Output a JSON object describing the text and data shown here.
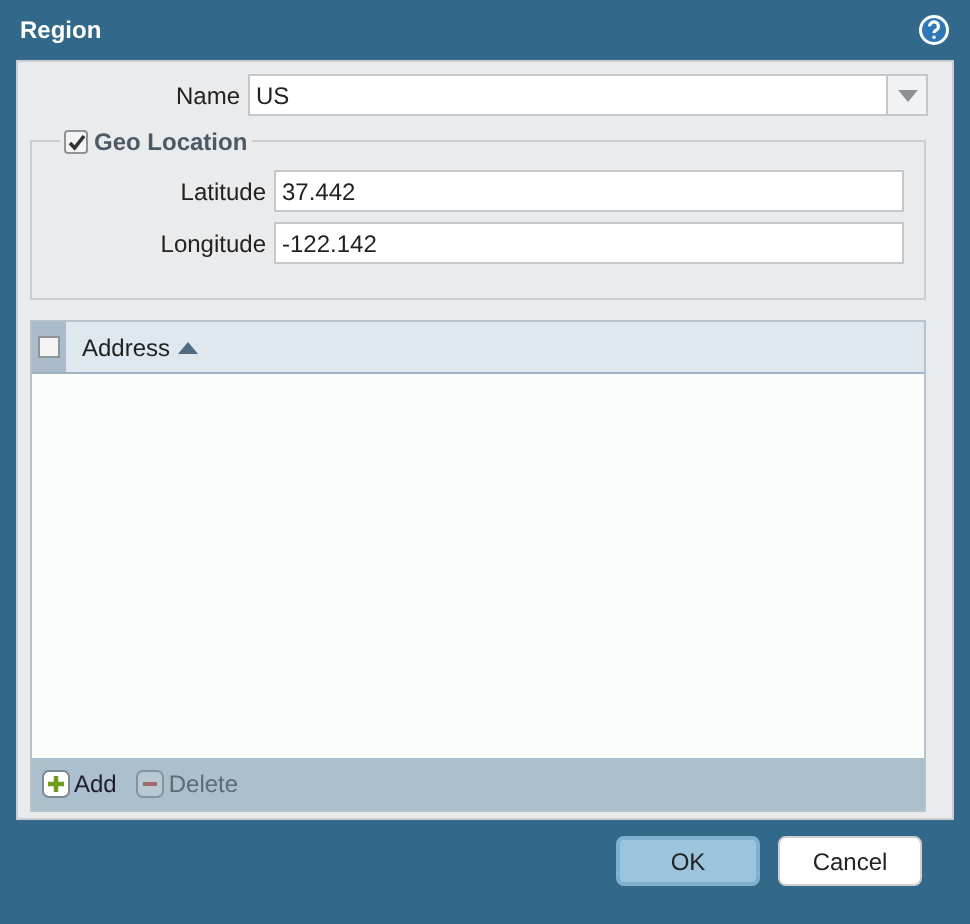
{
  "window": {
    "title": "Region"
  },
  "name_field": {
    "label": "Name",
    "value": "US"
  },
  "geo_location": {
    "label": "Geo Location",
    "checked": true,
    "fields": [
      {
        "label": "Latitude",
        "value": "37.442"
      },
      {
        "label": "Longitude",
        "value": "-122.142"
      }
    ]
  },
  "table": {
    "columns": [
      {
        "label": "Address",
        "sort_ascending": true
      }
    ],
    "select_all_checked": false
  },
  "table_actions": [
    {
      "label": "Add",
      "kind": "add",
      "disabled": false
    },
    {
      "label": "Delete",
      "kind": "delete",
      "disabled": true
    }
  ],
  "buttons": [
    {
      "label": "OK",
      "kind": "primary"
    },
    {
      "label": "Cancel",
      "kind": "secondary"
    }
  ]
}
